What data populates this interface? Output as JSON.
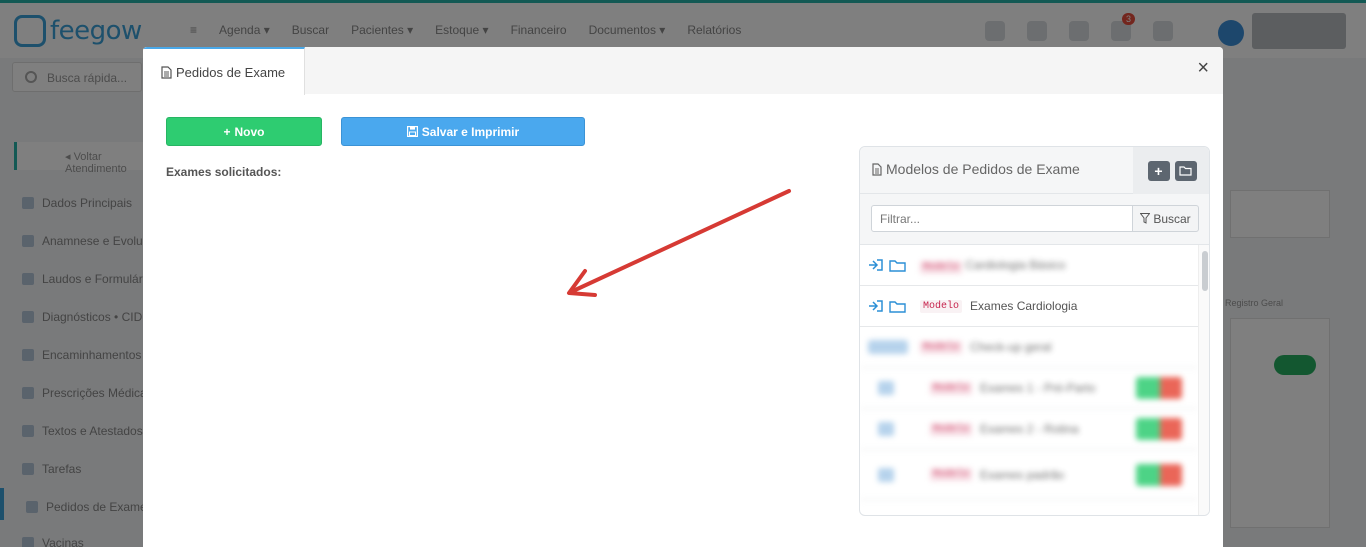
{
  "background": {
    "logo_text": "feegow",
    "nav_items": [
      "Agenda ▾",
      "Buscar",
      "Pacientes ▾",
      "Estoque ▾",
      "Financeiro",
      "Documentos ▾",
      "Relatórios"
    ],
    "notification_count": "3",
    "search_placeholder": "Busca rápida...",
    "back_label": "◂ Voltar Atendimento",
    "sidebar_items": [
      "Dados Principais",
      "Anamnese e Evolução",
      "Laudos e Formulários",
      "Diagnósticos • CID",
      "Encaminhamentos",
      "Prescrições Médicas",
      "Textos e Atestados",
      "Tarefas",
      "Pedidos de Exame",
      "Vacinas"
    ],
    "right_note": "Registro Geral"
  },
  "modal": {
    "tab_label": "Pedidos de Exame",
    "close_label": "×",
    "novo_label": "Novo",
    "salvar_label": "Salvar e Imprimir",
    "exames_label": "Exames solicitados:"
  },
  "models_panel": {
    "title": "Modelos de Pedidos de Exame",
    "add_label": "+",
    "filter_placeholder": "Filtrar...",
    "buscar_label": "Buscar",
    "rows": [
      {
        "badge": "Modelo",
        "text": "Cardiologia Básico",
        "blurred": true
      },
      {
        "badge": "Modelo",
        "text": "Exames Cardiologia",
        "blurred": false
      },
      {
        "badge": "Modelo",
        "text": "Check-up geral",
        "blurred": true
      },
      {
        "badge": "Modelo",
        "text": "Exames 1 - Pré-Parto",
        "blurred": true
      },
      {
        "badge": "Modelo",
        "text": "Exames 2 - Rotina",
        "blurred": true
      },
      {
        "badge": "Modelo",
        "text": "Exames padrão",
        "blurred": true
      }
    ]
  },
  "colors": {
    "accent_blue": "#4aa8ee",
    "success_green": "#2ecc71",
    "danger_red": "#e74c3c",
    "annotation_arrow": "#d63a34"
  }
}
